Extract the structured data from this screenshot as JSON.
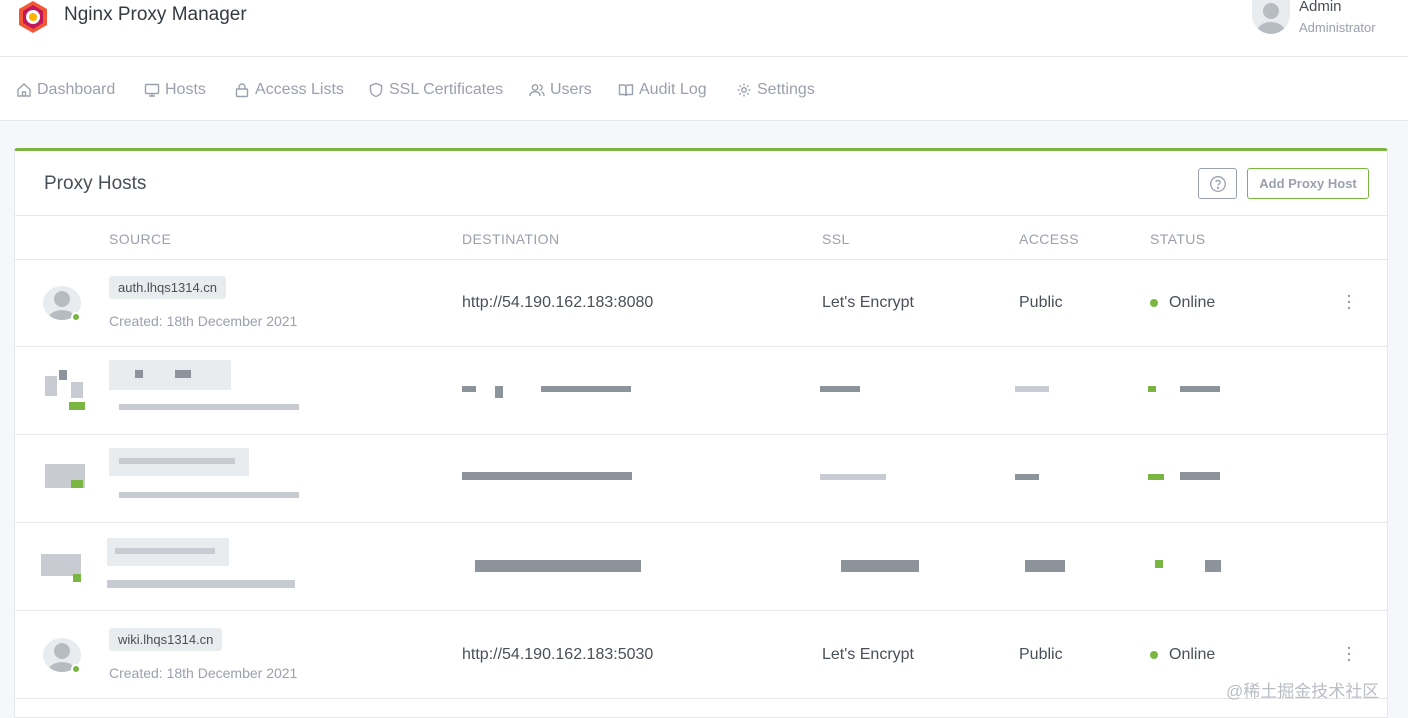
{
  "header": {
    "app_title": "Nginx Proxy Manager",
    "user_name": "Admin",
    "user_role": "Administrator"
  },
  "nav": [
    {
      "label": "Dashboard",
      "icon": "home-icon"
    },
    {
      "label": "Hosts",
      "icon": "monitor-icon"
    },
    {
      "label": "Access Lists",
      "icon": "lock-icon"
    },
    {
      "label": "SSL Certificates",
      "icon": "shield-icon"
    },
    {
      "label": "Users",
      "icon": "users-icon"
    },
    {
      "label": "Audit Log",
      "icon": "book-icon"
    },
    {
      "label": "Settings",
      "icon": "gear-icon"
    }
  ],
  "card": {
    "title": "Proxy Hosts",
    "add_label": "Add Proxy Host",
    "columns": {
      "source": "SOURCE",
      "destination": "DESTINATION",
      "ssl": "SSL",
      "access": "ACCESS",
      "status": "STATUS"
    }
  },
  "rows": [
    {
      "domain": "auth.lhqs1314.cn",
      "created": "Created: 18th December 2021",
      "destination": "http://54.190.162.183:8080",
      "ssl": "Let's Encrypt",
      "access": "Public",
      "status": "Online"
    },
    {
      "domain": "wiki.lhqs1314.cn",
      "created": "Created: 18th December 2021",
      "destination": "http://54.190.162.183:5030",
      "ssl": "Let's Encrypt",
      "access": "Public",
      "status": "Online"
    }
  ],
  "colors": {
    "accent": "#7bb642",
    "muted": "#9aa0ac"
  },
  "watermark": "@稀土掘金技术社区"
}
